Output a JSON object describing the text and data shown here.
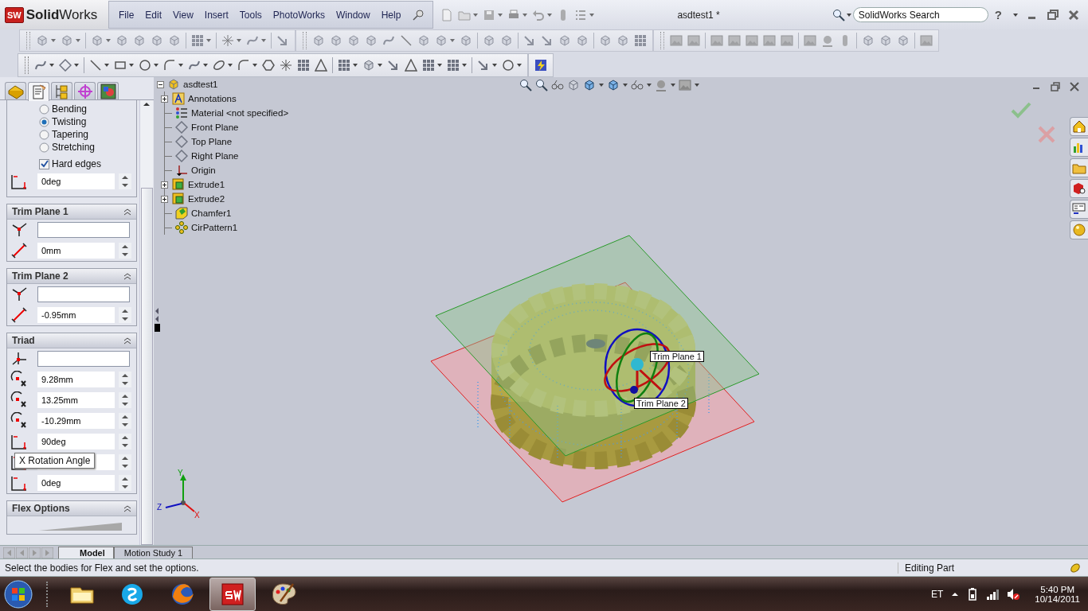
{
  "app": {
    "logo_badge": "SW",
    "logo": "**Solid**Works",
    "menu": [
      "File",
      "Edit",
      "View",
      "Insert",
      "Tools",
      "PhotoWorks",
      "Window",
      "Help"
    ],
    "document_title": "asdtest1 *",
    "search": {
      "placeholder": "SolidWorks Search"
    },
    "help": "?"
  },
  "property_panel": {
    "tabs": [
      {
        "selected": false
      },
      {
        "selected": true
      },
      {
        "selected": false
      },
      {
        "selected": false
      },
      {
        "selected": false
      }
    ],
    "flex_types": [
      {
        "label": "Bending",
        "selected": false
      },
      {
        "label": "Twisting",
        "selected": true
      },
      {
        "label": "Tapering",
        "selected": false
      },
      {
        "label": "Stretching",
        "selected": false
      }
    ],
    "hard_edges": {
      "label": "Hard edges",
      "checked": true
    },
    "angle": {
      "value": "0deg"
    },
    "sections": [
      {
        "title": "Trim Plane 1",
        "fields": [
          {
            "kind": "plane"
          },
          {
            "kind": "distance",
            "value": "0mm"
          }
        ]
      },
      {
        "title": "Trim Plane 2",
        "fields": [
          {
            "kind": "plane"
          },
          {
            "kind": "distance",
            "value": "-0.95mm"
          }
        ]
      },
      {
        "title": "Triad",
        "fields": [
          {
            "kind": "triad"
          },
          {
            "kind": "position",
            "value": "9.28mm"
          },
          {
            "kind": "position",
            "value": "13.25mm"
          },
          {
            "kind": "position",
            "value": "-10.29mm"
          },
          {
            "kind": "rotation",
            "value": "90deg",
            "tooltip": "X Rotation Angle"
          },
          {
            "kind": "rotation"
          },
          {
            "kind": "rotation",
            "value": "0deg"
          }
        ]
      },
      {
        "title": "Flex Options",
        "fields": [
          {
            "kind": "ramp"
          }
        ]
      }
    ]
  },
  "feature_tree": {
    "label": "asdtest1",
    "kind": "part",
    "expanded": true,
    "children": [
      {
        "label": "Annotations",
        "kind": "annotations",
        "expanded": false
      },
      {
        "label": "Material <not specified>",
        "kind": "material"
      },
      {
        "label": "Front Plane",
        "kind": "plane"
      },
      {
        "label": "Top Plane",
        "kind": "plane"
      },
      {
        "label": "Right Plane",
        "kind": "plane"
      },
      {
        "label": "Origin",
        "kind": "origin"
      },
      {
        "label": "Extrude1",
        "kind": "extrude",
        "expanded": false
      },
      {
        "label": "Extrude2",
        "kind": "extrude",
        "expanded": false
      },
      {
        "label": "Chamfer1",
        "kind": "chamfer"
      },
      {
        "label": "CirPattern1",
        "kind": "pattern"
      }
    ]
  },
  "viewport": {
    "plane_labels": [
      "Trim Plane 1",
      "Trim Plane 2"
    ],
    "axis_labels": [
      "Y",
      "Z",
      "X"
    ]
  },
  "bottom_tabs": [
    {
      "label": "Model",
      "selected": true
    },
    {
      "label": "Motion Study 1",
      "selected": false
    }
  ],
  "status_bar": {
    "message": "Select the bodies for Flex and set the options.",
    "mode": "Editing Part"
  },
  "taskbar": {
    "apps": [
      {
        "kind": "folder",
        "active": false
      },
      {
        "kind": "chat",
        "active": false
      },
      {
        "kind": "browser",
        "active": false
      },
      {
        "kind": "cad",
        "active": true
      },
      {
        "kind": "paint",
        "active": false
      }
    ],
    "language": "ET",
    "time": "5:40 PM",
    "date": "10/14/2011"
  }
}
